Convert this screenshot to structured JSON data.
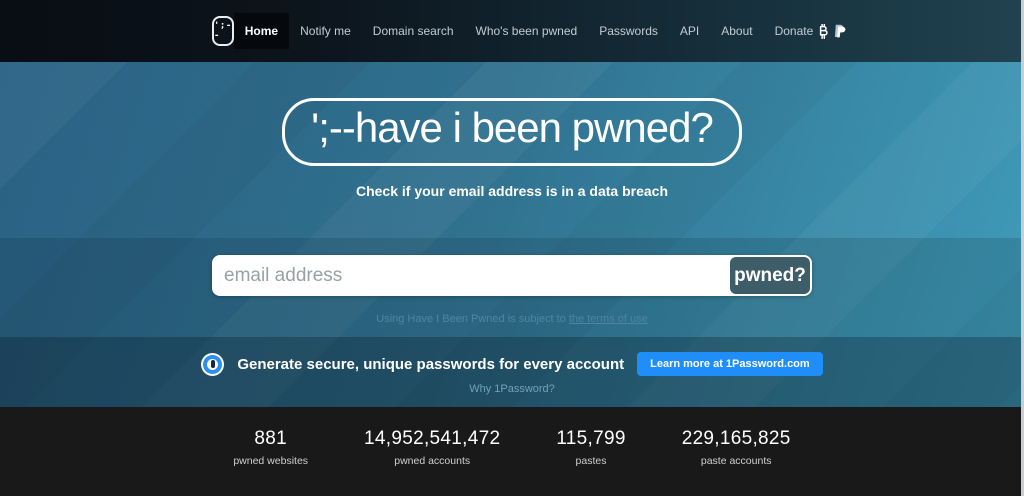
{
  "nav": {
    "logo_text": "';--",
    "items": [
      {
        "label": "Home",
        "active": true
      },
      {
        "label": "Notify me"
      },
      {
        "label": "Domain search"
      },
      {
        "label": "Who's been pwned"
      },
      {
        "label": "Passwords"
      },
      {
        "label": "API"
      },
      {
        "label": "About"
      },
      {
        "label": "Donate"
      }
    ],
    "donate_icons": [
      "bitcoin-icon",
      "paypal-icon"
    ]
  },
  "hero": {
    "title": "';--have i been pwned?",
    "subtitle": "Check if your email address is in a data breach"
  },
  "search": {
    "placeholder": "email address",
    "button_label": "pwned?",
    "terms_prefix": "Using Have I Been Pwned is subject to ",
    "terms_link": "the terms of use"
  },
  "promo": {
    "logo_icon": "1password-logo-icon",
    "text": "Generate secure, unique passwords for every account",
    "button_label": "Learn more at 1Password.com",
    "link_label": "Why 1Password?"
  },
  "stats": [
    {
      "value": "881",
      "label": "pwned websites"
    },
    {
      "value": "14,952,541,472",
      "label": "pwned accounts"
    },
    {
      "value": "115,799",
      "label": "pastes"
    },
    {
      "value": "229,165,825",
      "label": "paste accounts"
    }
  ],
  "colors": {
    "hero_gradient_start": "#2a6184",
    "hero_gradient_end": "#3f9cba",
    "navbar_dark": "#0c141c",
    "pwned_button": "#3d5d68",
    "promo_button_blue": "#1f8ef9",
    "stats_background": "#191919"
  }
}
